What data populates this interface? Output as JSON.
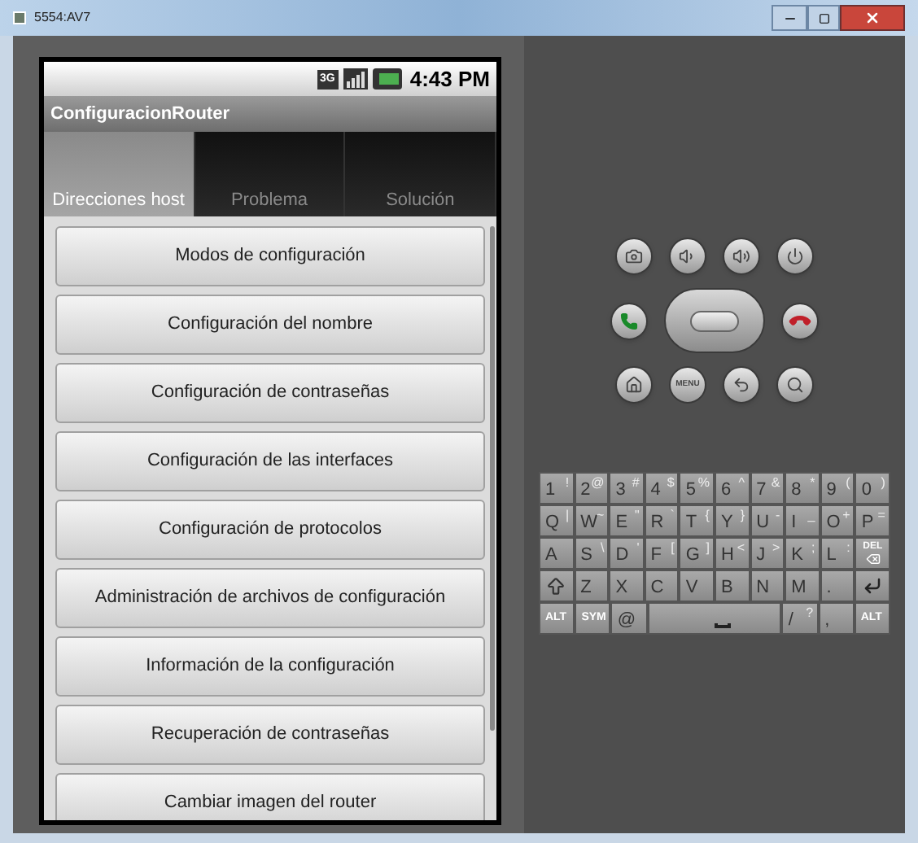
{
  "window": {
    "title": "5554:AV7"
  },
  "status_bar": {
    "network": "3G",
    "time": "4:43 PM"
  },
  "app": {
    "title": "ConfiguracionRouter"
  },
  "tabs": [
    {
      "label": "Direcciones host",
      "selected": true
    },
    {
      "label": "Problema",
      "selected": false
    },
    {
      "label": "Solución",
      "selected": false
    }
  ],
  "list_items": [
    "Modos de configuración",
    "Configuración del nombre",
    "Configuración de contraseñas",
    "Configuración de las interfaces",
    "Configuración de protocolos",
    "Administración de archivos de configuración",
    "Información de la configuración",
    "Recuperación de contraseñas",
    "Cambiar imagen del router"
  ],
  "menu_button": {
    "label": "MENU"
  },
  "keyboard": [
    [
      {
        "kind": "char",
        "main": "1",
        "alt": "!"
      },
      {
        "kind": "char",
        "main": "2",
        "alt": "@"
      },
      {
        "kind": "char",
        "main": "3",
        "alt": "#"
      },
      {
        "kind": "char",
        "main": "4",
        "alt": "$"
      },
      {
        "kind": "char",
        "main": "5",
        "alt": "%"
      },
      {
        "kind": "char",
        "main": "6",
        "alt": "^"
      },
      {
        "kind": "char",
        "main": "7",
        "alt": "&"
      },
      {
        "kind": "char",
        "main": "8",
        "alt": "*"
      },
      {
        "kind": "char",
        "main": "9",
        "alt": "("
      },
      {
        "kind": "char",
        "main": "0",
        "alt": ")"
      }
    ],
    [
      {
        "kind": "char",
        "main": "Q",
        "alt": "|"
      },
      {
        "kind": "char",
        "main": "W",
        "alt": "~"
      },
      {
        "kind": "char",
        "main": "E",
        "alt": "\""
      },
      {
        "kind": "char",
        "main": "R",
        "alt": "`"
      },
      {
        "kind": "char",
        "main": "T",
        "alt": "{"
      },
      {
        "kind": "char",
        "main": "Y",
        "alt": "}"
      },
      {
        "kind": "char",
        "main": "U",
        "alt": "-"
      },
      {
        "kind": "char",
        "main": "I",
        "alt": "_"
      },
      {
        "kind": "char",
        "main": "O",
        "alt": "+"
      },
      {
        "kind": "char",
        "main": "P",
        "alt": "="
      }
    ],
    [
      {
        "kind": "char",
        "main": "A"
      },
      {
        "kind": "char",
        "main": "S",
        "alt": "\\"
      },
      {
        "kind": "char",
        "main": "D",
        "alt": "'"
      },
      {
        "kind": "char",
        "main": "F",
        "alt": "["
      },
      {
        "kind": "char",
        "main": "G",
        "alt": "]"
      },
      {
        "kind": "char",
        "main": "H",
        "alt": "<"
      },
      {
        "kind": "char",
        "main": "J",
        "alt": ">"
      },
      {
        "kind": "char",
        "main": "K",
        "alt": ";"
      },
      {
        "kind": "char",
        "main": "L",
        "alt": ":"
      },
      {
        "kind": "del",
        "main": "DEL"
      }
    ],
    [
      {
        "kind": "shift"
      },
      {
        "kind": "char",
        "main": "Z"
      },
      {
        "kind": "char",
        "main": "X"
      },
      {
        "kind": "char",
        "main": "C"
      },
      {
        "kind": "char",
        "main": "V"
      },
      {
        "kind": "char",
        "main": "B"
      },
      {
        "kind": "char",
        "main": "N"
      },
      {
        "kind": "char",
        "main": "M"
      },
      {
        "kind": "char",
        "main": "."
      },
      {
        "kind": "enter"
      }
    ],
    [
      {
        "kind": "label",
        "main": "ALT"
      },
      {
        "kind": "label",
        "main": "SYM"
      },
      {
        "kind": "char",
        "main": "@"
      },
      {
        "kind": "space"
      },
      {
        "kind": "char",
        "main": "/",
        "alt": "?"
      },
      {
        "kind": "char",
        "main": ","
      },
      {
        "kind": "label",
        "main": "ALT"
      }
    ]
  ]
}
